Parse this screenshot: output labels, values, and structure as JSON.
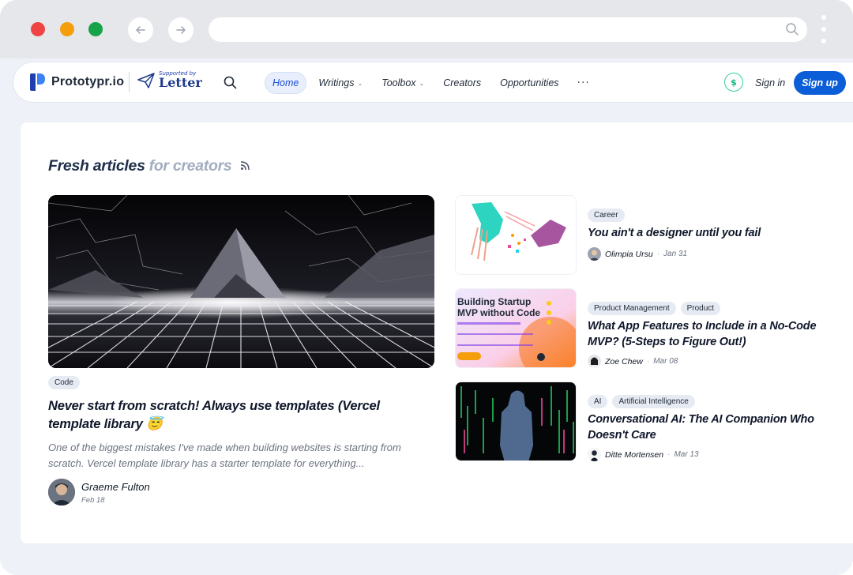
{
  "browser": {
    "url": ""
  },
  "header": {
    "logo_text": "Prototypr.io",
    "sponsor_sup": "Supported by",
    "sponsor_name": "Letter",
    "nav": [
      {
        "label": "Home",
        "active": true,
        "dropdown": false
      },
      {
        "label": "Writings",
        "active": false,
        "dropdown": true
      },
      {
        "label": "Toolbox",
        "active": false,
        "dropdown": true
      },
      {
        "label": "Creators",
        "active": false,
        "dropdown": false
      },
      {
        "label": "Opportunities",
        "active": false,
        "dropdown": false
      }
    ],
    "more_label": "···",
    "dollar_icon": "$",
    "signin_label": "Sign in",
    "signup_label": "Sign up"
  },
  "section": {
    "title_main": "Fresh articles",
    "title_sub": "for creators"
  },
  "featured": {
    "tag": "Code",
    "title": "Never start from scratch! Always use templates (Vercel template library 😇",
    "description": "One of the biggest mistakes I've made when building websites is starting from scratch. Vercel template library has a starter template for everything...",
    "author": "Graeme Fulton",
    "date": "Feb 18"
  },
  "side_articles": [
    {
      "tags": [
        "Career"
      ],
      "title": "You ain't a designer until you fail",
      "author": "Olimpia Ursu",
      "date": "Jan 31"
    },
    {
      "tags": [
        "Product Management",
        "Product"
      ],
      "title": "What App Features to Include in a No-Code MVP? (5-Steps to Figure Out!)",
      "author": "Zoe Chew",
      "date": "Mar 08",
      "thumb_text_1": "Building Startup",
      "thumb_text_2": "MVP without Code"
    },
    {
      "tags": [
        "AI",
        "Artificial Intelligence"
      ],
      "title": "Conversational AI: The AI Companion Who Doesn't Care",
      "author": "Ditte Mortensen",
      "date": "Mar 13"
    }
  ],
  "colors": {
    "accent": "#0b5ed7",
    "nav_active_bg": "#e8eefb",
    "tag_bg": "#e6ebf3"
  }
}
